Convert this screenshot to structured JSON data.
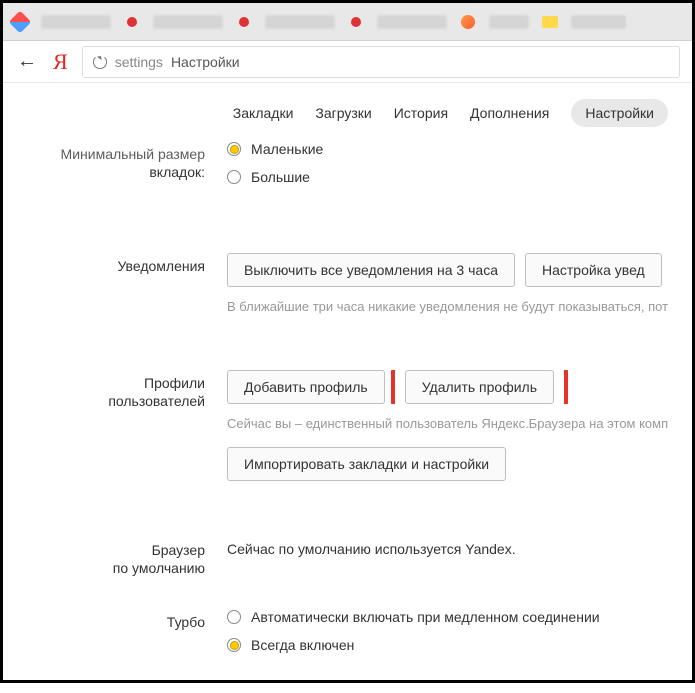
{
  "address": {
    "prefix": "settings",
    "title": " Настройки"
  },
  "nav": {
    "bookmarks": "Закладки",
    "downloads": "Загрузки",
    "history": "История",
    "addons": "Дополнения",
    "settings": "Настройки"
  },
  "tabsize": {
    "label_line1": "Минимальный размер",
    "label_line2": "вкладок:",
    "small": "Маленькие",
    "large": "Большие"
  },
  "notifications": {
    "label": "Уведомления",
    "mute_btn": "Выключить все уведомления на 3 часа",
    "settings_btn": "Настройка увед",
    "hint": "В ближайшие три часа никакие уведомления не будут показываться, пот"
  },
  "profiles": {
    "label_line1": "Профили",
    "label_line2": "пользователей",
    "add_btn": "Добавить профиль",
    "delete_btn": "Удалить профиль",
    "hint": "Сейчас вы – единственный пользователь Яндекс.Браузера на этом комп",
    "import_btn": "Импортировать закладки и настройки"
  },
  "default_browser": {
    "label_line1": "Браузер",
    "label_line2": "по умолчанию",
    "text": "Сейчас по умолчанию используется Yandex."
  },
  "turbo": {
    "label": "Турбо",
    "auto": "Автоматически включать при медленном соединении",
    "always": "Всегда включен"
  }
}
